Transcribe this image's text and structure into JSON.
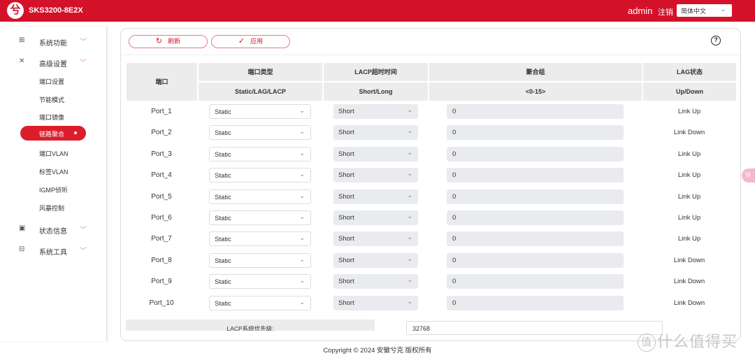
{
  "header": {
    "logo_glyph": "兮",
    "model": "SKS3200-8E2X",
    "user": "admin",
    "logout_label": "注销",
    "language": "简体中文"
  },
  "sidebar": {
    "groups": [
      {
        "label": "系统功能",
        "icon": "grid-icon",
        "glyph": "⊞"
      },
      {
        "label": "高级设置",
        "icon": "tools-icon",
        "glyph": "✕"
      },
      {
        "label": "状态信息",
        "icon": "monitor-icon",
        "glyph": "▣"
      },
      {
        "label": "系统工具",
        "icon": "toolbox-icon",
        "glyph": "⊟"
      }
    ],
    "sub_items": [
      "端口设置",
      "节能模式",
      "端口镜像",
      "链路聚合",
      "端口VLAN",
      "标签VLAN",
      "IGMP侦听",
      "风暴控制"
    ],
    "active_item": "链路聚合"
  },
  "toolbar": {
    "refresh_label": "刷新",
    "apply_label": "应用",
    "help_glyph": "?"
  },
  "table": {
    "headers": {
      "port": "端口",
      "type": "端口类型",
      "type_sub": "Static/LAG/LACP",
      "lacp_timeout": "LACP超时时间",
      "lacp_timeout_sub": "Short/Long",
      "group": "聚合组",
      "group_sub": "<0-15>",
      "lag_status": "LAG状态",
      "lag_status_sub": "Up/Down"
    },
    "rows": [
      {
        "port": "Port_1",
        "type": "Static",
        "lacp_timeout": "Short",
        "group": "0",
        "status": "Link Up"
      },
      {
        "port": "Port_2",
        "type": "Static",
        "lacp_timeout": "Short",
        "group": "0",
        "status": "Link Down"
      },
      {
        "port": "Port_3",
        "type": "Static",
        "lacp_timeout": "Short",
        "group": "0",
        "status": "Link Up"
      },
      {
        "port": "Port_4",
        "type": "Static",
        "lacp_timeout": "Short",
        "group": "0",
        "status": "Link Up"
      },
      {
        "port": "Port_5",
        "type": "Static",
        "lacp_timeout": "Short",
        "group": "0",
        "status": "Link Up"
      },
      {
        "port": "Port_6",
        "type": "Static",
        "lacp_timeout": "Short",
        "group": "0",
        "status": "Link Up"
      },
      {
        "port": "Port_7",
        "type": "Static",
        "lacp_timeout": "Short",
        "group": "0",
        "status": "Link Up"
      },
      {
        "port": "Port_8",
        "type": "Static",
        "lacp_timeout": "Short",
        "group": "0",
        "status": "Link Down"
      },
      {
        "port": "Port_9",
        "type": "Static",
        "lacp_timeout": "Short",
        "group": "0",
        "status": "Link Down"
      },
      {
        "port": "Port_10",
        "type": "Static",
        "lacp_timeout": "Short",
        "group": "0",
        "status": "Link Down"
      }
    ]
  },
  "lacp_priority": {
    "label": "LACP系统优先级:",
    "value": "32768"
  },
  "footer": {
    "copyright": "Copyright © 2024 安徽兮克 版权所有"
  },
  "overlay": {
    "float_badge": "快",
    "watermark_circle": "值",
    "watermark_text": "什么值得买"
  },
  "colors": {
    "brand": "#d3122a",
    "active_nav": "#dc1e2c"
  }
}
